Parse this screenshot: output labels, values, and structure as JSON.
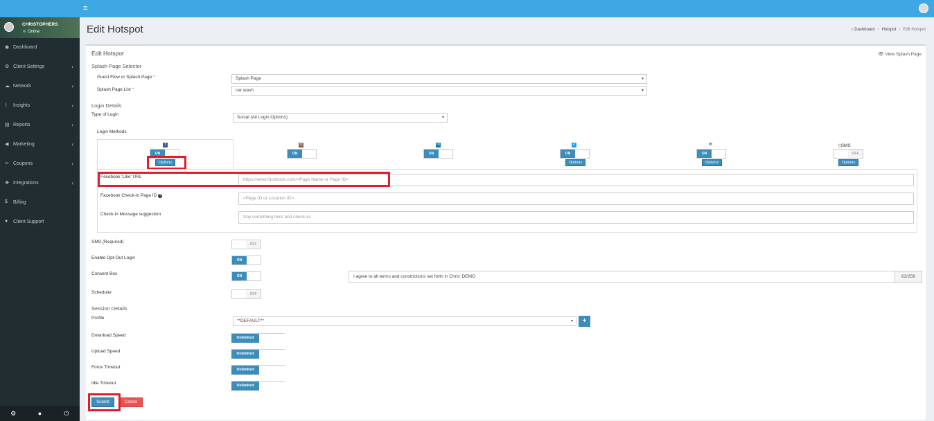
{
  "topbar": {
    "menu_icon": "hamburger-icon",
    "avatar_icon": "user-avatar-icon"
  },
  "user": {
    "name": "CHRISTOPHERS",
    "status": "Online"
  },
  "sidebar": {
    "items": [
      {
        "label": "Dashboard",
        "icon": "dashboard-icon",
        "glyph": "◉",
        "chevron": ""
      },
      {
        "label": "Client Settings",
        "icon": "gear-icon",
        "glyph": "⚙",
        "chevron": "‹"
      },
      {
        "label": "Network",
        "icon": "cloud-icon",
        "glyph": "☁",
        "chevron": "‹"
      },
      {
        "label": "Insights",
        "icon": "chart-icon",
        "glyph": "⌇",
        "chevron": "‹"
      },
      {
        "label": "Reports",
        "icon": "reports-icon",
        "glyph": "▤",
        "chevron": "‹"
      },
      {
        "label": "Marketing",
        "icon": "bullhorn-icon",
        "glyph": "◀",
        "chevron": "‹"
      },
      {
        "label": "Coupons",
        "icon": "coupon-icon",
        "glyph": "✂",
        "chevron": "‹"
      },
      {
        "label": "Integrations",
        "icon": "puzzle-icon",
        "glyph": "❖",
        "chevron": "‹"
      },
      {
        "label": "Billing",
        "icon": "dollar-icon",
        "glyph": "$",
        "chevron": ""
      },
      {
        "label": "Client Support",
        "icon": "support-icon",
        "glyph": "●",
        "chevron": ""
      }
    ],
    "footer": {
      "settings": "⚙",
      "profile": "●",
      "power": "⏻"
    }
  },
  "page": {
    "title": "Edit Hotspot",
    "breadcrumb": {
      "home_glyph": "⌂",
      "home": "Dashboard",
      "mid": "Hotspot",
      "current": "Edit Hotspot",
      "sep": "›"
    }
  },
  "box": {
    "title": "Edit Hotspot",
    "view_splash": "👁 View Splash Page"
  },
  "splash": {
    "heading": "Splash Page Selector",
    "guest_flow_label": "Guest Flow or Splash Page",
    "guest_flow_value": "Splash Page",
    "list_label": "Splash Page List",
    "list_value": "car wash",
    "req": "*"
  },
  "login": {
    "heading": "Login Details",
    "type_label": "Type of Login",
    "type_value": "Social (All Login Options)",
    "methods_label": "Login Methods",
    "sms_label": "SMS"
  },
  "toggles": {
    "on": "ON",
    "off": "OFF",
    "options": "Options",
    "unlimited": "Unlimited"
  },
  "facebook": {
    "like_label": "Facebook 'Like' URL",
    "like_placeholder": "https://www.facebook.com/<Page Name or Page ID>",
    "checkin_label": "Facebook Check-in Page ID",
    "checkin_placeholder": "<Page ID or Location ID>",
    "msg_label": "Check-in Message suggestion",
    "msg_placeholder": "Say something here and check-in."
  },
  "settings": {
    "sms_req": "SMS (Required)",
    "opt_out": "Enable Opt-Out Login",
    "consent": "Consent Box",
    "consent_text": "I agree to all terms and constrictions set forth in Chris' DEMO",
    "consent_count": "63/256",
    "scheduler": "Scheduler"
  },
  "session": {
    "heading": "Session Details",
    "profile_label": "Profile",
    "profile_value": "**DEFAULT**",
    "add": "+",
    "download": "Download Speed",
    "upload": "Upload Speed",
    "force": "Force Timeout",
    "idle": "Idle Timeout"
  },
  "actions": {
    "submit": "Submit",
    "cancel": "Cancel"
  },
  "colors": {
    "topbar": "#3ea8e5",
    "sidebar": "#222d32",
    "primary": "#3c8dbc",
    "cancel": "#f05050",
    "highlight": "#e01d2a"
  }
}
